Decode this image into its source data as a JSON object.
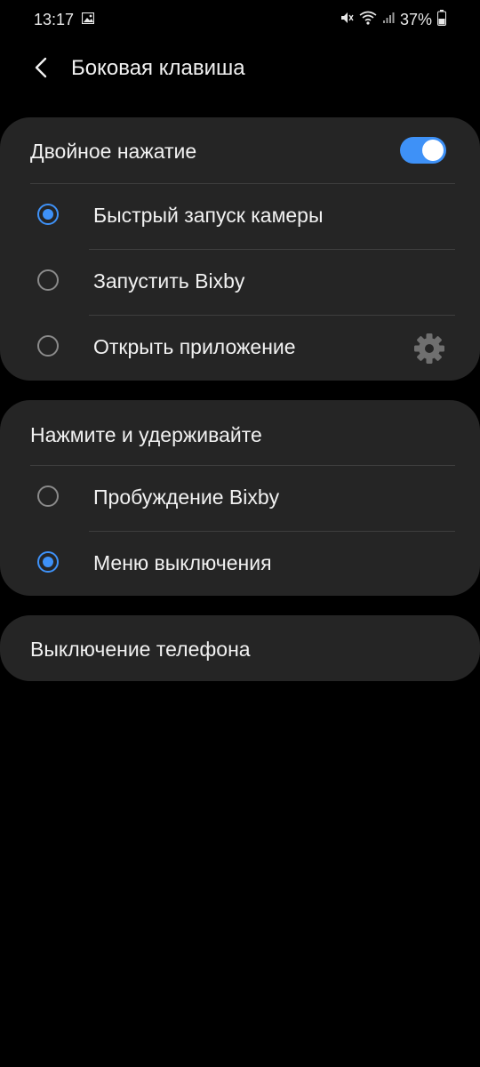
{
  "status_bar": {
    "time": "13:17",
    "battery": "37%",
    "icons": [
      "gallery-icon",
      "mute-icon",
      "wifi-icon",
      "signal-icon",
      "battery-icon"
    ]
  },
  "header": {
    "title": "Боковая клавиша",
    "back_icon": "chevron-left-icon"
  },
  "double_press": {
    "title": "Двойное нажатие",
    "toggle_on": true,
    "options": [
      {
        "label": "Быстрый запуск камеры",
        "selected": true
      },
      {
        "label": "Запустить Bixby",
        "selected": false
      },
      {
        "label": "Открыть приложение",
        "selected": false,
        "settings_icon": "gear-icon"
      }
    ]
  },
  "press_hold": {
    "title": "Нажмите и удерживайте",
    "options": [
      {
        "label": "Пробуждение Bixby",
        "selected": false
      },
      {
        "label": "Меню выключения",
        "selected": true
      }
    ]
  },
  "power_off": {
    "label": "Выключение телефона"
  },
  "colors": {
    "background": "#000000",
    "card": "#252525",
    "accent": "#3e91f7",
    "text": "#f1f1f1",
    "divider": "#3e3e3e"
  }
}
